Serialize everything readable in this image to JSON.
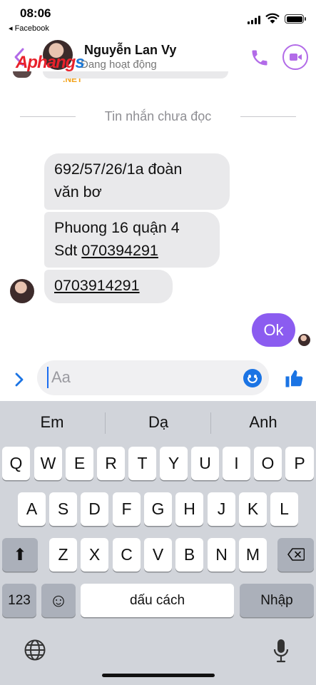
{
  "status_bar": {
    "time": "08:06",
    "back_app": "◂ Facebook"
  },
  "watermark": {
    "brand_main": "Aphang",
    "brand_s": "s",
    "brand_net": ".NET"
  },
  "header": {
    "contact_name": "Nguyễn Lan Vy",
    "status": "Đang hoạt động",
    "accent_color": "#b26be8"
  },
  "chat": {
    "unread_divider": "Tin nhắn chưa đọc",
    "messages": [
      {
        "lines": [
          "692/57/26/1a đoàn",
          "văn bơ"
        ]
      },
      {
        "line1": "Phuong 16 quận 4",
        "prefix": "Sdt ",
        "link": "070394291"
      },
      {
        "link": "0703914291"
      }
    ],
    "my_reply": "Ok",
    "reply_color": "#8b5cf0"
  },
  "composer": {
    "placeholder": "Aa",
    "value": ""
  },
  "keyboard": {
    "suggestions": [
      "Em",
      "Dạ",
      "Anh"
    ],
    "row1": [
      "Q",
      "W",
      "E",
      "R",
      "T",
      "Y",
      "U",
      "I",
      "O",
      "P"
    ],
    "row2": [
      "A",
      "S",
      "D",
      "F",
      "G",
      "H",
      "J",
      "K",
      "L"
    ],
    "row3": [
      "Z",
      "X",
      "C",
      "V",
      "B",
      "N",
      "M"
    ],
    "numbers_key": "123",
    "space_key": "dấu cách",
    "return_key": "Nhập",
    "shift_glyph": "⬆",
    "emoji_glyph": "☺"
  }
}
